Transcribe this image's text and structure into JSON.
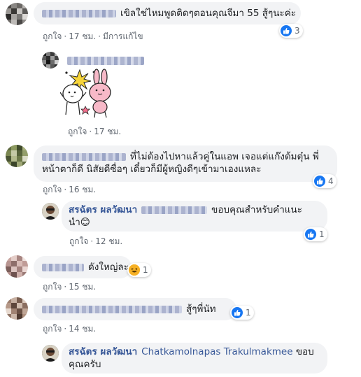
{
  "comments": [
    {
      "text": "เขิลใช่ไหมพูดติดๆตอนคุณจีมา 55 สู้ๆนะค่ะ",
      "like_label": "ถูกใจ",
      "time": "17 ชม.",
      "edited": "มีการแก้ไข",
      "reaction_count": "3"
    },
    {
      "like_label": "ถูกใจ",
      "time": "17 ชม."
    },
    {
      "text": "ที่ไม่ต้องไปหาแล้วคู่ในแอพ เจอแต่แก๊งต้มตุ๋น พี่หน้าตาก็ดี นิสัยดีซื่อๆ เดี๋ยวก็มีผู้หญิงดีๆเข้ามาเองแหละ",
      "text_line1": "ที่ไม่ต้องไปหาแล้วคู่ในแอพ เจอแต่แก๊งต้มตุ๋น พี่",
      "text_line2": "หน้าตาก็ดี นิสัยดีซื่อๆ เดี๋ยวก็มีผู้หญิงดีๆเข้ามาเองแหละ",
      "like_label": "ถูกใจ",
      "time": "16 ชม.",
      "reaction_count": "4"
    },
    {
      "author": "สรฉัตร ผลวัฒนา",
      "text_line1": "ขอบคุณสำหรับคำแนะ",
      "text_line2": "นำ😊",
      "like_label": "ถูกใจ",
      "time": "12 ชม.",
      "reaction_count": "1"
    },
    {
      "text": "ดังใหญ่ละ",
      "like_label": "ถูกใจ",
      "time": "15 ชม.",
      "reaction_count": "1"
    },
    {
      "text": "สู้ๆพี่นัท",
      "like_label": "ถูกใจ",
      "time": "14 ชม.",
      "reaction_count": "1"
    },
    {
      "author": "สรฉัตร ผลวัฒนา",
      "mention": "Chatkamolnapas Trakulmakmee",
      "text_line1": "ขอบ",
      "text_line2": "คุณครับ"
    }
  ],
  "icons": {
    "like": "thumbs-up-icon",
    "haha": "haha-emoji-icon"
  },
  "colors": {
    "bubble": "#f2f3f5",
    "link": "#385898",
    "like_blue": "#1877f2",
    "meta": "#606770"
  }
}
